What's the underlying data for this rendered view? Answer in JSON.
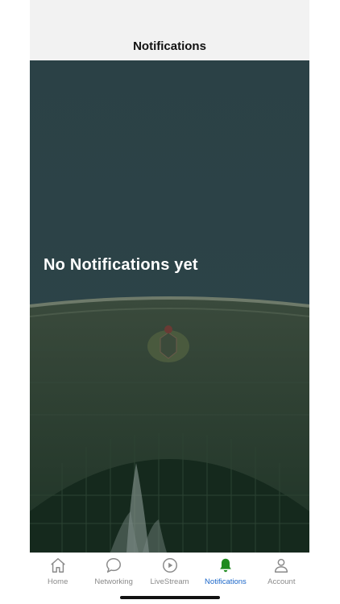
{
  "header": {
    "title": "Notifications"
  },
  "empty_state": {
    "message": "No Notifications yet"
  },
  "tabbar": {
    "items": [
      {
        "label": "Home",
        "icon": "home-icon",
        "active": false
      },
      {
        "label": "Networking",
        "icon": "chat-bubble-icon",
        "active": false
      },
      {
        "label": "LiveStream",
        "icon": "play-circle-icon",
        "active": false
      },
      {
        "label": "Notifications",
        "icon": "bell-icon",
        "active": true
      },
      {
        "label": "Account",
        "icon": "person-icon",
        "active": false
      }
    ]
  },
  "colors": {
    "header_bg": "#f2f2f2",
    "overlay": "#2a4146",
    "active_tab": "#1a66c9",
    "active_icon": "#1f8a1f",
    "inactive": "#8a8a8a"
  }
}
